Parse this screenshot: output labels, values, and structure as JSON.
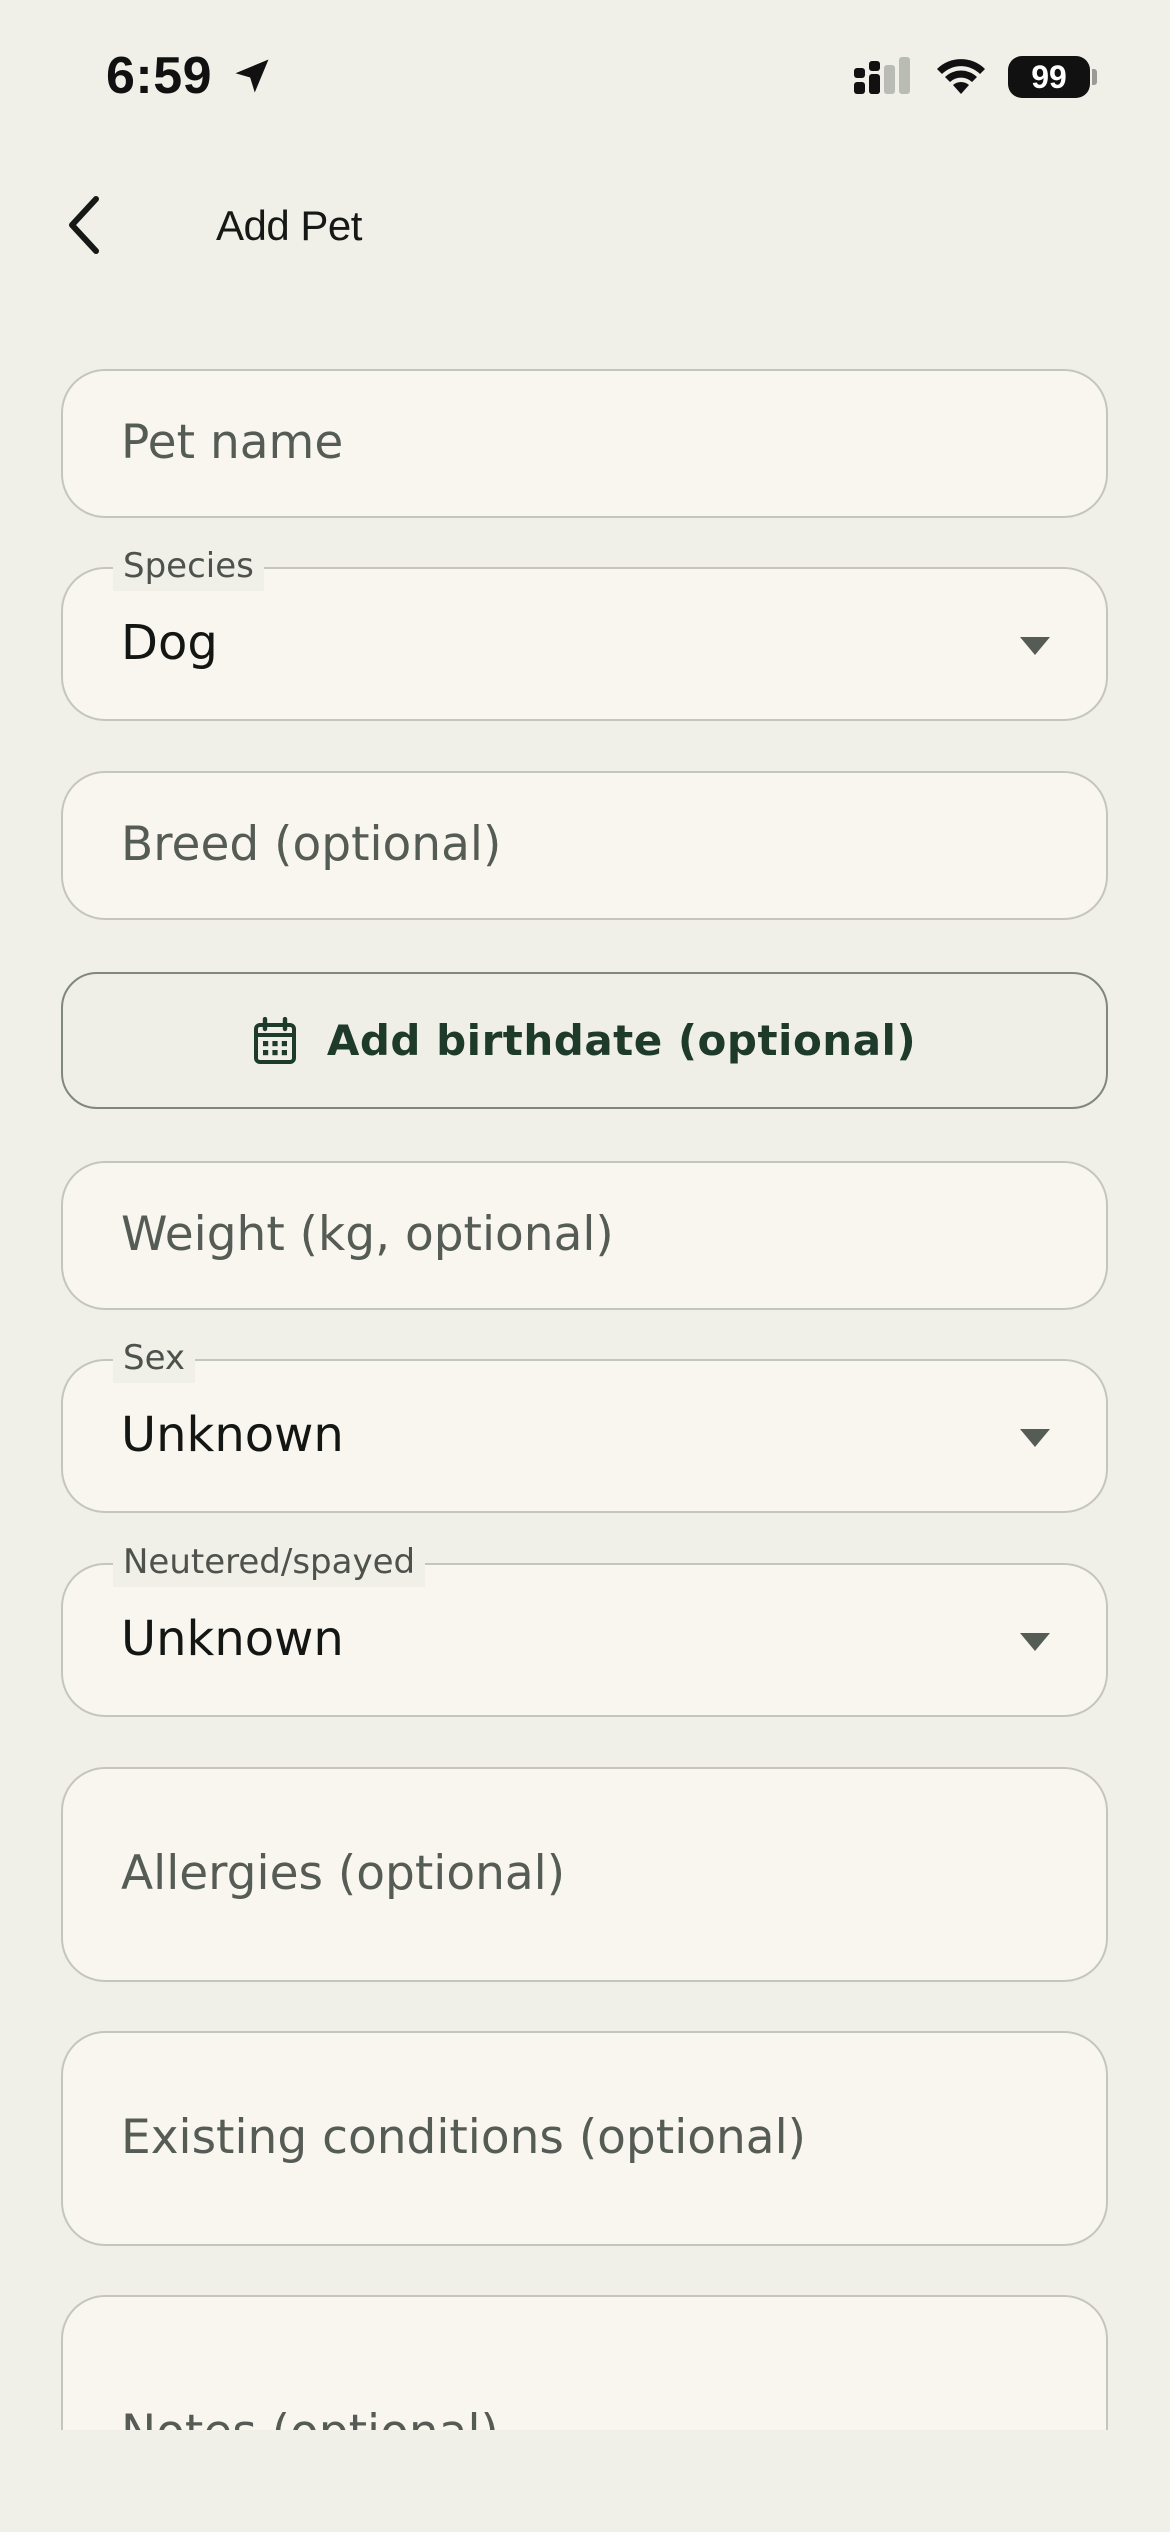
{
  "status_bar": {
    "time": "6:59",
    "battery": "99",
    "icons": [
      "location-arrow-icon",
      "cellular-signal-icon",
      "wifi-icon",
      "battery-icon"
    ]
  },
  "app_bar": {
    "title": "Add Pet",
    "back_icon": "chevron-left-icon"
  },
  "form": {
    "pet_name": {
      "placeholder": "Pet name",
      "value": ""
    },
    "species": {
      "label": "Species",
      "value": "Dog"
    },
    "breed": {
      "placeholder": "Breed (optional)",
      "value": ""
    },
    "birthdate_button": {
      "label": "Add birthdate (optional)",
      "icon": "calendar-icon"
    },
    "weight": {
      "placeholder": "Weight (kg, optional)",
      "value": ""
    },
    "sex": {
      "label": "Sex",
      "value": "Unknown"
    },
    "neutered": {
      "label": "Neutered/spayed",
      "value": "Unknown"
    },
    "allergies": {
      "placeholder": "Allergies (optional)",
      "value": ""
    },
    "conditions": {
      "placeholder": "Existing conditions (optional)",
      "value": ""
    },
    "notes": {
      "placeholder": "Notes (optional)",
      "value": ""
    }
  },
  "colors": {
    "background": "#f0efe8",
    "field_fill": "#f9f6ef",
    "field_border": "#c3c6bf",
    "accent_text": "#1e3a2a"
  }
}
